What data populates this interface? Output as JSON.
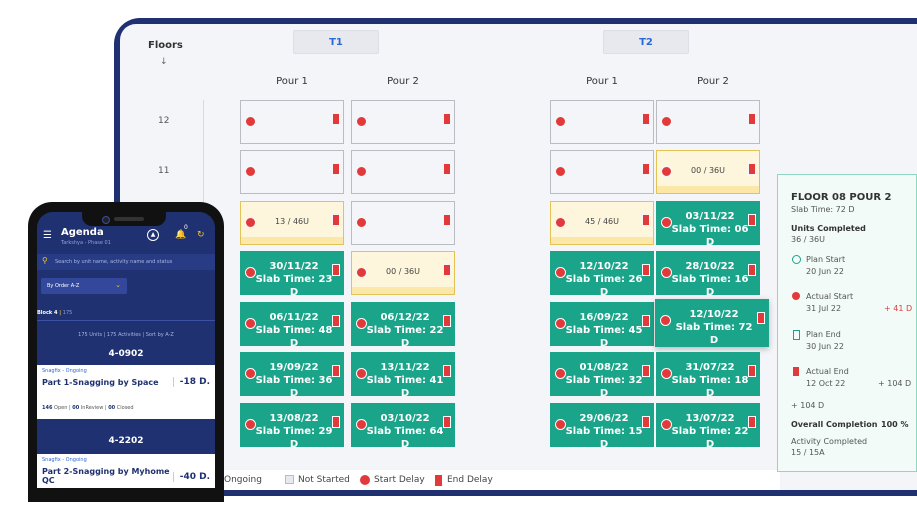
{
  "board": {
    "floors_label": "Floors",
    "floors_arrow": "↓",
    "towers": [
      "T1",
      "T2"
    ],
    "pour_labels": [
      "Pour 1",
      "Pour 2",
      "Pour 1",
      "Pour 2"
    ],
    "floor_numbers": [
      "12",
      "11"
    ]
  },
  "cells": [
    {
      "state": "empty"
    },
    {
      "state": "empty"
    },
    {
      "state": "empty"
    },
    {
      "state": "empty"
    },
    {
      "state": "empty"
    },
    {
      "state": "empty"
    },
    {
      "state": "empty"
    },
    {
      "state": "prog",
      "units": "00 / 36U"
    },
    {
      "state": "prog",
      "units": "13 / 46U"
    },
    {
      "state": "empty"
    },
    {
      "state": "prog",
      "units": "45 / 46U"
    },
    {
      "state": "done",
      "date": "03/11/22",
      "slab": "Slab Time: 06 D"
    },
    {
      "state": "done",
      "date": "30/11/22",
      "slab": "Slab Time: 23 D"
    },
    {
      "state": "prog",
      "units": "00 / 36U"
    },
    {
      "state": "done",
      "date": "12/10/22",
      "slab": "Slab Time: 26 D"
    },
    {
      "state": "done",
      "date": "28/10/22",
      "slab": "Slab Time: 16 D"
    },
    {
      "state": "done",
      "date": "06/11/22",
      "slab": "Slab Time: 48 D"
    },
    {
      "state": "done",
      "date": "06/12/22",
      "slab": "Slab Time: 22 D"
    },
    {
      "state": "done",
      "date": "16/09/22",
      "slab": "Slab Time: 45 D"
    },
    {
      "state": "done",
      "date": "12/10/22",
      "slab": "Slab Time: 72 D"
    },
    {
      "state": "done",
      "date": "19/09/22",
      "slab": "Slab Time: 36 D"
    },
    {
      "state": "done",
      "date": "13/11/22",
      "slab": "Slab Time: 41 D"
    },
    {
      "state": "done",
      "date": "01/08/22",
      "slab": "Slab Time: 32 D"
    },
    {
      "state": "done",
      "date": "31/07/22",
      "slab": "Slab Time: 18 D"
    },
    {
      "state": "done",
      "date": "13/08/22",
      "slab": "Slab Time: 29 D"
    },
    {
      "state": "done",
      "date": "03/10/22",
      "slab": "Slab Time: 64 D"
    },
    {
      "state": "done",
      "date": "29/06/22",
      "slab": "Slab Time: 15 D"
    },
    {
      "state": "done",
      "date": "13/07/22",
      "slab": "Slab Time: 22 D"
    }
  ],
  "legend": {
    "ongoing": "Ongoing",
    "not_started": "Not Started",
    "start_delay": "Start Delay",
    "end_delay": "End Delay"
  },
  "detail": {
    "title": "FLOOR 08 POUR 2",
    "slab_time": "Slab Time: 72 D",
    "units_label": "Units Completed",
    "units_value": "36 / 36U",
    "plan_start_label": "Plan Start",
    "plan_start": "20 Jun 22",
    "actual_start_label": "Actual Start",
    "actual_start": "31 Jul 22",
    "actual_start_delta": "+ 41 D",
    "plan_end_label": "Plan End",
    "plan_end": "30 Jun 22",
    "actual_end_label": "Actual End",
    "actual_end": "12 Oct 22",
    "actual_end_delta": "+ 104 D",
    "extra_delta": "+ 104 D",
    "overall_label": "Overall Completion",
    "overall_value": "100 %",
    "activity_label": "Activity Completed",
    "activity_value": "15 / 15A"
  },
  "phone": {
    "title": "Agenda",
    "subtitle": "Tarkshya - Phase 01",
    "notif_count": "0",
    "search_placeholder": "Search by unit name, activity name and status",
    "sort": "By Order A-Z",
    "block": "Block 4",
    "block_count": "175",
    "meta": "175 Units | 175 Activities | Sort by A-Z",
    "groups": [
      {
        "code": "4-0902",
        "tag": "Snagfix - Ongoing",
        "name": "Part 1-Snagging by Space",
        "delay": "-18 D.",
        "open": "146",
        "open_label": "Open",
        "inreview": "00",
        "inreview_label": "InReview",
        "closed": "00",
        "closed_label": "Closed"
      },
      {
        "code": "4-2202",
        "tag": "Snagfix - Ongoing",
        "name": "Part 2-Snagging by Myhome QC",
        "delay": "-40 D."
      }
    ]
  },
  "colors": {
    "navy": "#1f3170",
    "done": "#1aa58a",
    "delay": "#e23a3a",
    "progress": "#fdf6dc"
  }
}
